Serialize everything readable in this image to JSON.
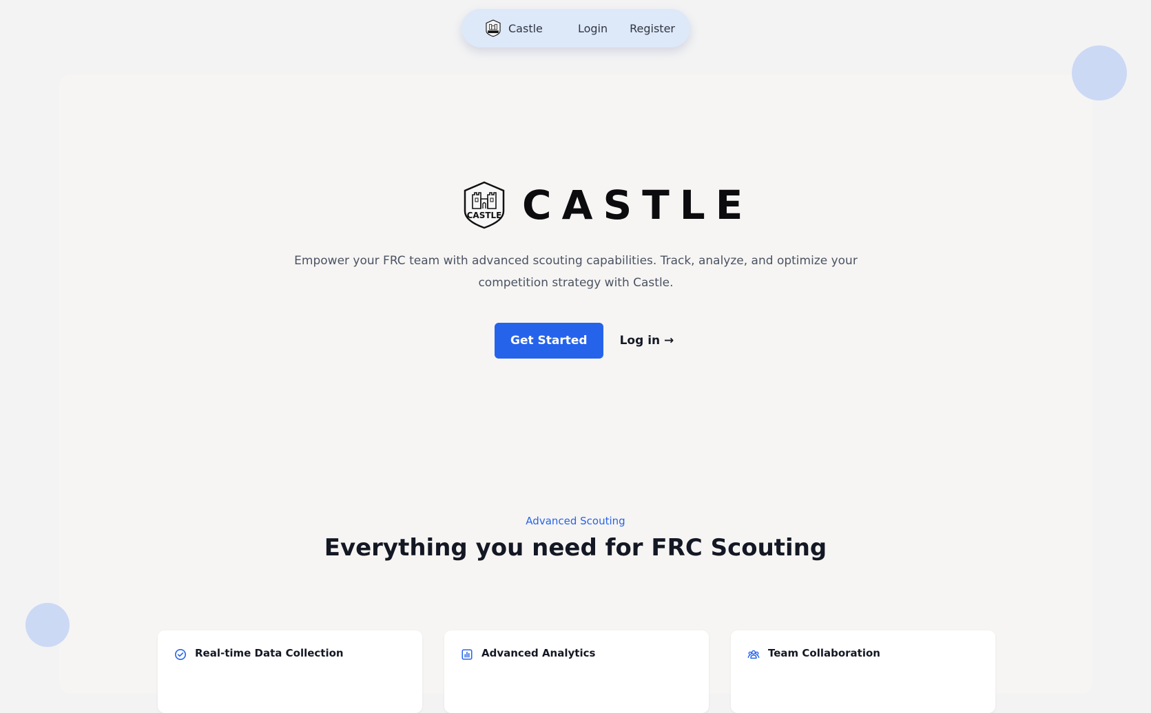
{
  "nav": {
    "brand_label": "Castle",
    "logo_icon": "castle-shield-icon",
    "links": [
      {
        "label": "Login"
      },
      {
        "label": "Register"
      }
    ]
  },
  "hero": {
    "wordmark": "CASTLE",
    "logo_icon": "castle-shield-icon",
    "logo_text": "CASTLE",
    "description": "Empower your FRC team with advanced scouting capabilities. Track, analyze, and optimize your competition strategy with Castle.",
    "primary_button": "Get Started",
    "secondary_link": "Log in →"
  },
  "features": {
    "eyebrow": "Advanced Scouting",
    "title": "Everything you need for FRC Scouting",
    "cards": [
      {
        "title": "Real-time Data Collection",
        "icon": "check-circle-icon"
      },
      {
        "title": "Advanced Analytics",
        "icon": "bar-chart-icon"
      },
      {
        "title": "Team Collaboration",
        "icon": "users-icon"
      }
    ]
  },
  "colors": {
    "accent": "#2563eb",
    "nav_bg": "#dde8f8",
    "page_bg": "#f3f3f4",
    "panel_bg": "#f6f5f3",
    "blob": "#c4d3f4"
  }
}
